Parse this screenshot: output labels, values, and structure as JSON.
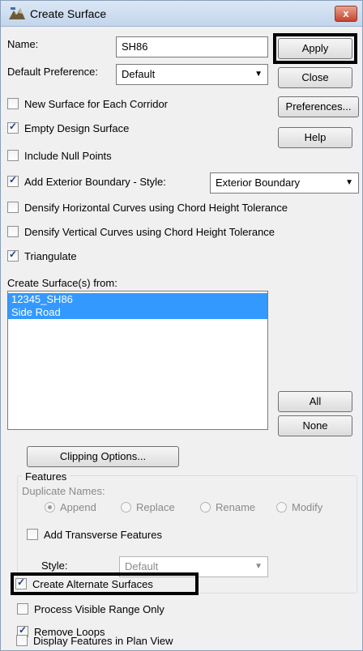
{
  "window": {
    "title": "Create Surface",
    "close_glyph": "x"
  },
  "form": {
    "name_label": "Name:",
    "name_value": "SH86",
    "default_pref_label": "Default Preference:",
    "default_pref_value": "Default"
  },
  "buttons": {
    "apply": "Apply",
    "close": "Close",
    "preferences": "Preferences...",
    "help": "Help",
    "all": "All",
    "none": "None",
    "clipping": "Clipping Options..."
  },
  "options": {
    "new_surface": {
      "label": "New Surface for Each Corridor",
      "checked": false
    },
    "empty_design": {
      "label": "Empty Design Surface",
      "checked": true
    },
    "include_null": {
      "label": "Include Null Points",
      "checked": false
    },
    "add_exterior": {
      "label": "Add Exterior Boundary - Style:",
      "checked": true
    },
    "exterior_style_value": "Exterior Boundary",
    "densify_horizontal": {
      "label": "Densify Horizontal Curves using Chord Height Tolerance",
      "checked": false
    },
    "densify_vertical": {
      "label": "Densify Vertical Curves using Chord Height Tolerance",
      "checked": false
    },
    "triangulate": {
      "label": "Triangulate",
      "checked": true
    }
  },
  "surfaces": {
    "label": "Create Surface(s) from:",
    "items": [
      "12345_SH86",
      "Side Road"
    ]
  },
  "features": {
    "group_label": "Features",
    "duplicate_label": "Duplicate Names:",
    "radios": [
      "Append",
      "Replace",
      "Rename",
      "Modify"
    ],
    "selected_radio": "Append",
    "add_transverse": {
      "label": "Add Transverse Features",
      "checked": false
    },
    "style_label": "Style:",
    "style_value": "Default"
  },
  "bottom": {
    "create_alternate": {
      "label": "Create Alternate Surfaces",
      "checked": true
    },
    "process_visible": {
      "label": "Process Visible Range Only",
      "checked": false
    },
    "remove_loops": {
      "label": "Remove Loops",
      "checked": true
    },
    "display_features": {
      "label": "Display Features in Plan View",
      "checked": false
    }
  },
  "colors": {
    "selection": "#3399ff",
    "highlight_border": "#000000",
    "dialog_bg": "#f0f0f0"
  }
}
